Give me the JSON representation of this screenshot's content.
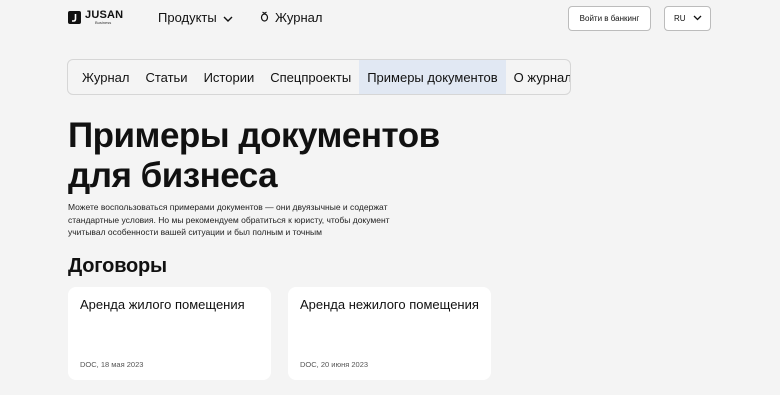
{
  "header": {
    "logo": {
      "brand": "JUSAN",
      "sub": "Business"
    },
    "products_label": "Продукты",
    "journal_label": "Журнал",
    "bank_button_label": "Войти в банкинг",
    "language": "RU"
  },
  "tabs": [
    {
      "label": "Журнал",
      "active": false
    },
    {
      "label": "Статьи",
      "active": false
    },
    {
      "label": "Истории",
      "active": false
    },
    {
      "label": "Спецпроекты",
      "active": false
    },
    {
      "label": "Примеры документов",
      "active": true
    },
    {
      "label": "О журнале",
      "active": false
    }
  ],
  "page": {
    "title_line1": "Примеры документов",
    "title_line2": "для бизнеса",
    "description": "Можете воспользоваться примерами документов — они двуязычные и содержат стандартные условия. Но мы рекомендуем обратиться к юристу, чтобы документ учитывал особенности вашей ситуации и был полным и точным"
  },
  "section": {
    "title": "Договоры"
  },
  "cards": [
    {
      "title": "Аренда жилого помещения",
      "meta": "DOC, 18 мая 2023"
    },
    {
      "title": "Аренда нежилого помещения",
      "meta": "DOC, 20 июня 2023"
    }
  ],
  "colors": {
    "background": "#f4f4f4",
    "active_tab": "#e1e8f3",
    "card": "#ffffff",
    "text": "#111111"
  },
  "icons": {
    "logo": "jusan-logo-icon",
    "products_chevron": "chevron-down-icon",
    "journal": "journal-icon",
    "language_chevron": "chevron-down-icon"
  }
}
